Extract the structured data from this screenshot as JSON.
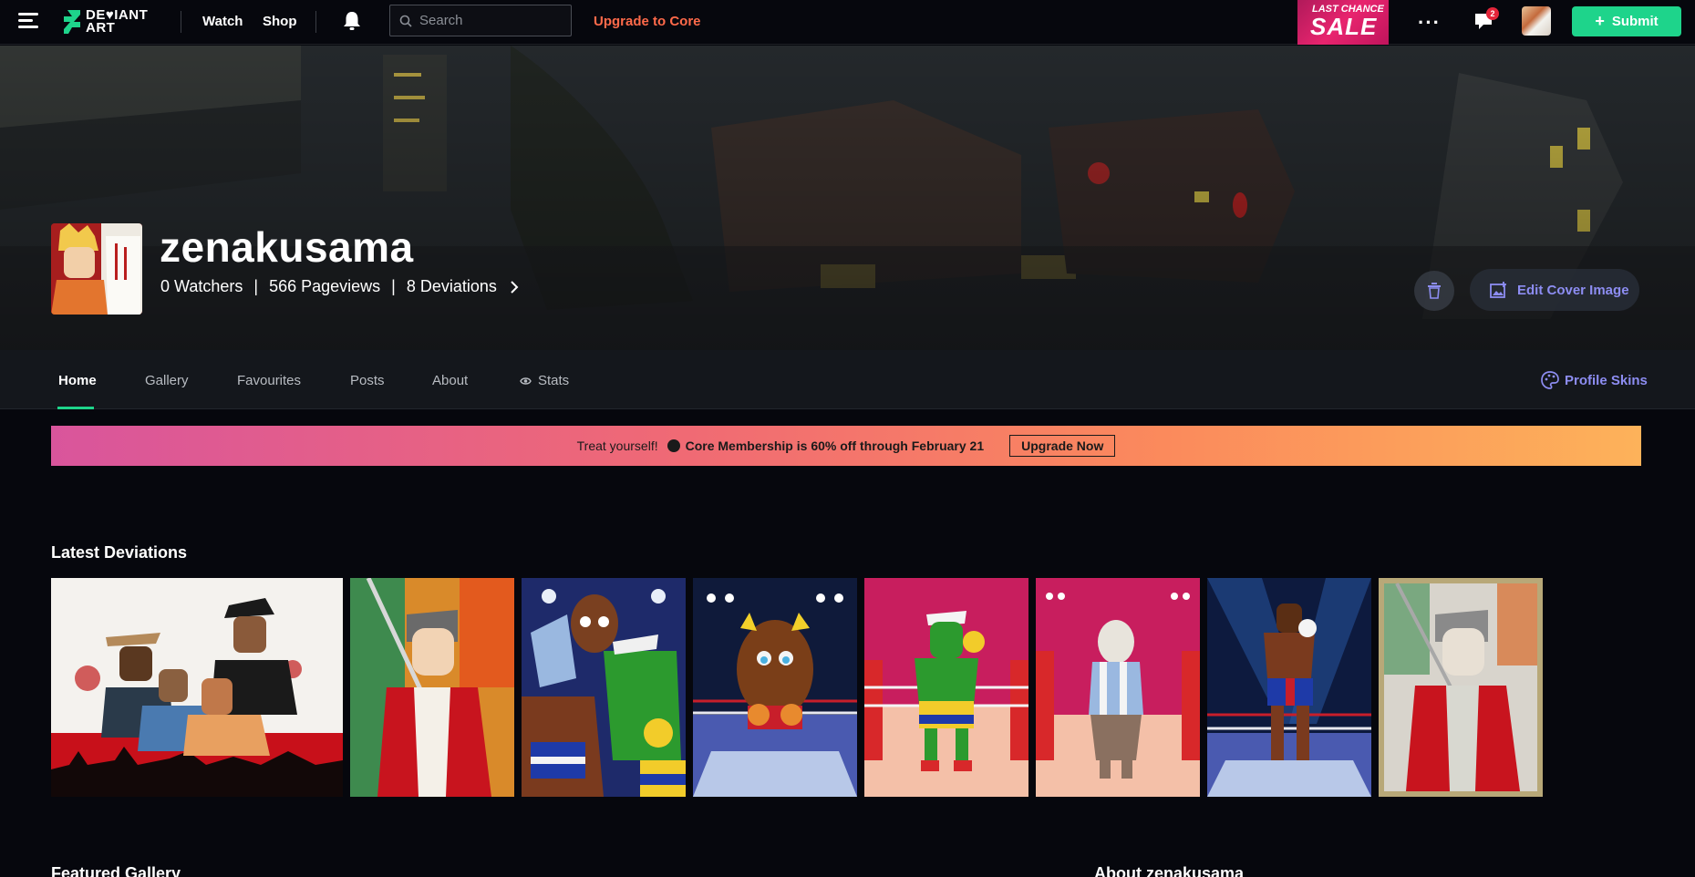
{
  "topbar": {
    "logo_line1": "DE♥IANT",
    "logo_line2": "ART",
    "watch": "Watch",
    "shop": "Shop",
    "search_placeholder": "Search",
    "upgrade": "Upgrade to Core",
    "sale_small": "LAST CHANCE",
    "sale_big": "SALE",
    "more": "···",
    "notif_count": "2",
    "submit": "Submit"
  },
  "profile": {
    "username": "zenakusama",
    "watchers": "0 Watchers",
    "pageviews": "566 Pageviews",
    "deviations": "8 Deviations",
    "sep": "|",
    "edit_cover": "Edit Cover Image"
  },
  "tabs": {
    "home": "Home",
    "gallery": "Gallery",
    "favourites": "Favourites",
    "posts": "Posts",
    "about": "About",
    "stats": "Stats",
    "profile_skins": "Profile Skins"
  },
  "promo": {
    "treat": "Treat yourself!",
    "core": "Core Membership is 60% off through February 21",
    "button": "Upgrade Now"
  },
  "sections": {
    "latest": "Latest Deviations",
    "featured": "Featured Gallery",
    "about": "About zenakusama"
  },
  "colors": {
    "accent_green": "#1ed48b",
    "accent_purple": "#8d8df2",
    "upgrade_orange": "#ff6a4a",
    "background": "#06070d"
  }
}
